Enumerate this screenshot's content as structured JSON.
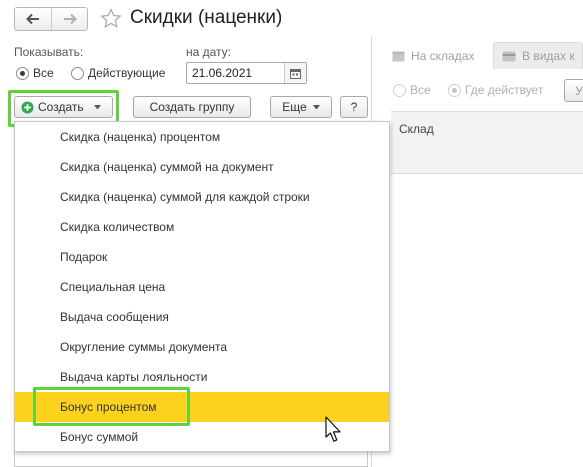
{
  "header": {
    "title": "Скидки (наценки)"
  },
  "filters": {
    "show_label": "Показывать:",
    "options": [
      "Все",
      "Действующие"
    ],
    "selected": "Все",
    "date_label": "на дату:",
    "date_value": "21.06.2021"
  },
  "toolbar": {
    "create_label": "Создать",
    "create_group_label": "Создать группу",
    "more_label": "Еще",
    "help_label": "?"
  },
  "create_menu": {
    "items": [
      "Скидка (наценка) процентом",
      "Скидка (наценка) суммой на документ",
      "Скидка (наценка) суммой для каждой строки",
      "Скидка количеством",
      "Подарок",
      "Специальная цена",
      "Выдача сообщения",
      "Округление суммы документа",
      "Выдача карты лояльности",
      "Бонус процентом",
      "Бонус суммой"
    ],
    "highlighted": "Бонус процентом"
  },
  "right_pane": {
    "tabs": [
      "На складах",
      "В видах к"
    ],
    "selected_tab": "В видах к",
    "radio_options": [
      "Все",
      "Где действует"
    ],
    "radio_selected": "Где действует",
    "column_header": "Склад"
  },
  "colors": {
    "highlight_border": "#5cd43a",
    "menu_active": "#fcd21c",
    "create_icon": "#2fa84f"
  }
}
